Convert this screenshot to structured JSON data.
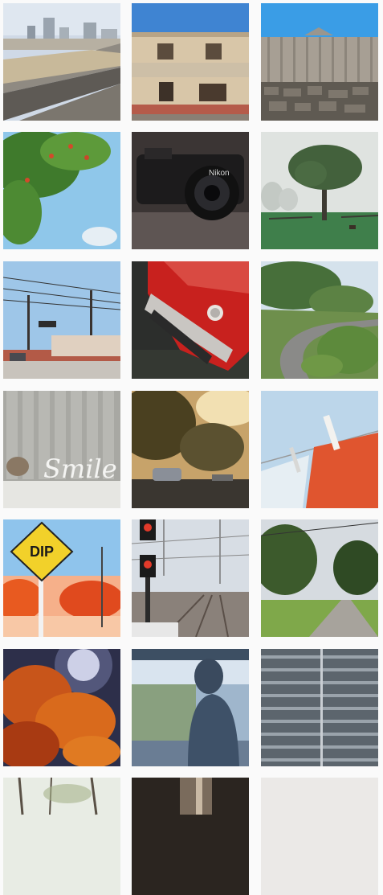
{
  "gallery": {
    "photos": [
      {
        "subject": "city-skyline-railway"
      },
      {
        "subject": "old-building-facade"
      },
      {
        "subject": "wooden-barn-stone-wall"
      },
      {
        "subject": "leaves-blue-sky"
      },
      {
        "subject": "nikon-camera"
      },
      {
        "subject": "foggy-tree-field"
      },
      {
        "subject": "street-power-lines"
      },
      {
        "subject": "red-vintage-car"
      },
      {
        "subject": "winding-road-hills"
      },
      {
        "subject": "smile-sign-cat"
      },
      {
        "subject": "sunlit-street-car"
      },
      {
        "subject": "clothespin-laundry"
      },
      {
        "subject": "dip-road-sign"
      },
      {
        "subject": "railway-signals"
      },
      {
        "subject": "country-path"
      },
      {
        "subject": "autumn-leaves-sun"
      },
      {
        "subject": "silhouette-window"
      },
      {
        "subject": "stairs"
      },
      {
        "subject": "bare-trees"
      },
      {
        "subject": "dark-interior"
      },
      {
        "subject": "pale-sky"
      }
    ],
    "dip_sign_text": "DIP",
    "smile_text": "Smile",
    "camera_brand_text": "Nikon"
  }
}
